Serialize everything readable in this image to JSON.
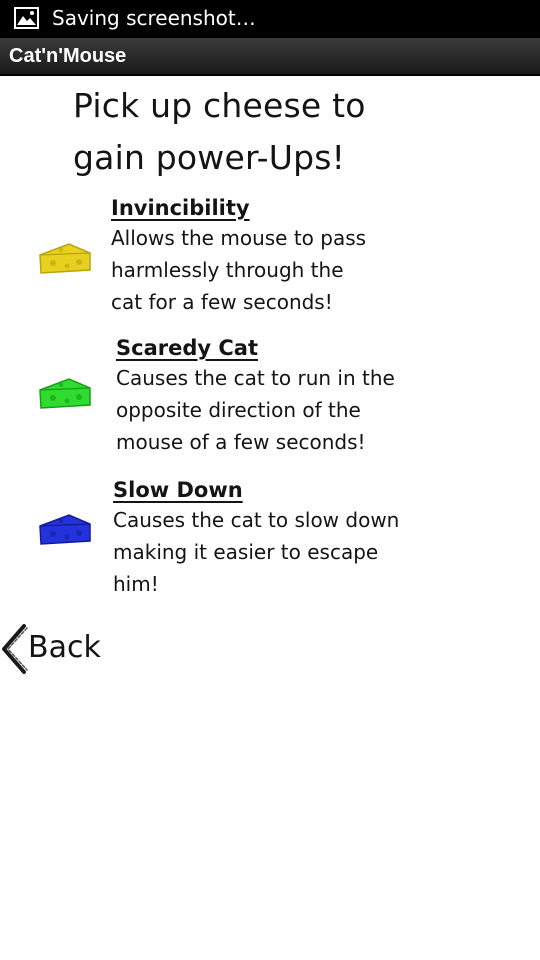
{
  "status_bar": {
    "notification_icon": "image-icon",
    "text": "Saving screenshot…"
  },
  "app_bar": {
    "title": "Cat'n'Mouse"
  },
  "headline": {
    "line1": "Pick up cheese to",
    "line2": "gain power-Ups!"
  },
  "powerups": [
    {
      "name": "Invincibility",
      "description": "Allows the mouse to pass\nharmlessly through the\ncat for a few seconds!",
      "cheese_icon": "cheese-icon",
      "color": "#e6d21e"
    },
    {
      "name": "Scaredy Cat",
      "description": "Causes the cat to run in the\nopposite direction of the\nmouse of a few seconds!",
      "cheese_icon": "cheese-icon",
      "color": "#2edb2e"
    },
    {
      "name": "Slow Down",
      "description": "Causes the cat to slow down\nmaking it easier to escape\nhim!",
      "cheese_icon": "cheese-icon",
      "color": "#2432dc"
    }
  ],
  "back_button": {
    "label": "Back",
    "icon": "chevron-left-icon"
  }
}
